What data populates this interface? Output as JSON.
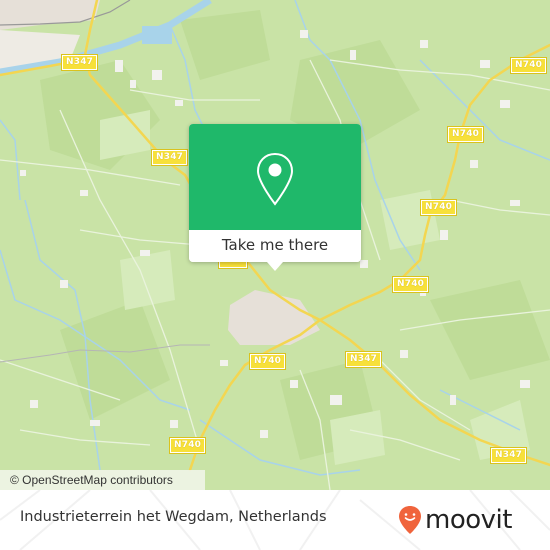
{
  "map": {
    "attribution": "© OpenStreetMap contributors",
    "road_labels": [
      {
        "id": "n347-top-left",
        "text": "N347"
      },
      {
        "id": "n347-mid-left",
        "text": "N347"
      },
      {
        "id": "n740-top-right",
        "text": "N740"
      },
      {
        "id": "n740-right-1",
        "text": "N740"
      },
      {
        "id": "n740-right-2",
        "text": "N740"
      },
      {
        "id": "n740-center-right",
        "text": "N740"
      },
      {
        "id": "n740-center",
        "text": "N740"
      },
      {
        "id": "n347-center",
        "text": "N347"
      },
      {
        "id": "n740-bottom-left",
        "text": "N740"
      },
      {
        "id": "n347-bottom-right",
        "text": "N347"
      }
    ],
    "colors": {
      "land": "#c9e3a6",
      "forest": "#b9d98f",
      "urban": "#e6e0d8",
      "water": "#a8d3ea",
      "road": "#f3d651",
      "road_label_bg": "#f7e03a"
    }
  },
  "popup": {
    "icon": "location-pin-icon",
    "action_label": "Take me there",
    "color": "#1fb86a"
  },
  "footer": {
    "location_name": "Industrieterrein het Wegdam, Netherlands",
    "brand": "moovit",
    "brand_icon": "moovit-smiley-pin-icon",
    "brand_color": "#f0643c"
  }
}
